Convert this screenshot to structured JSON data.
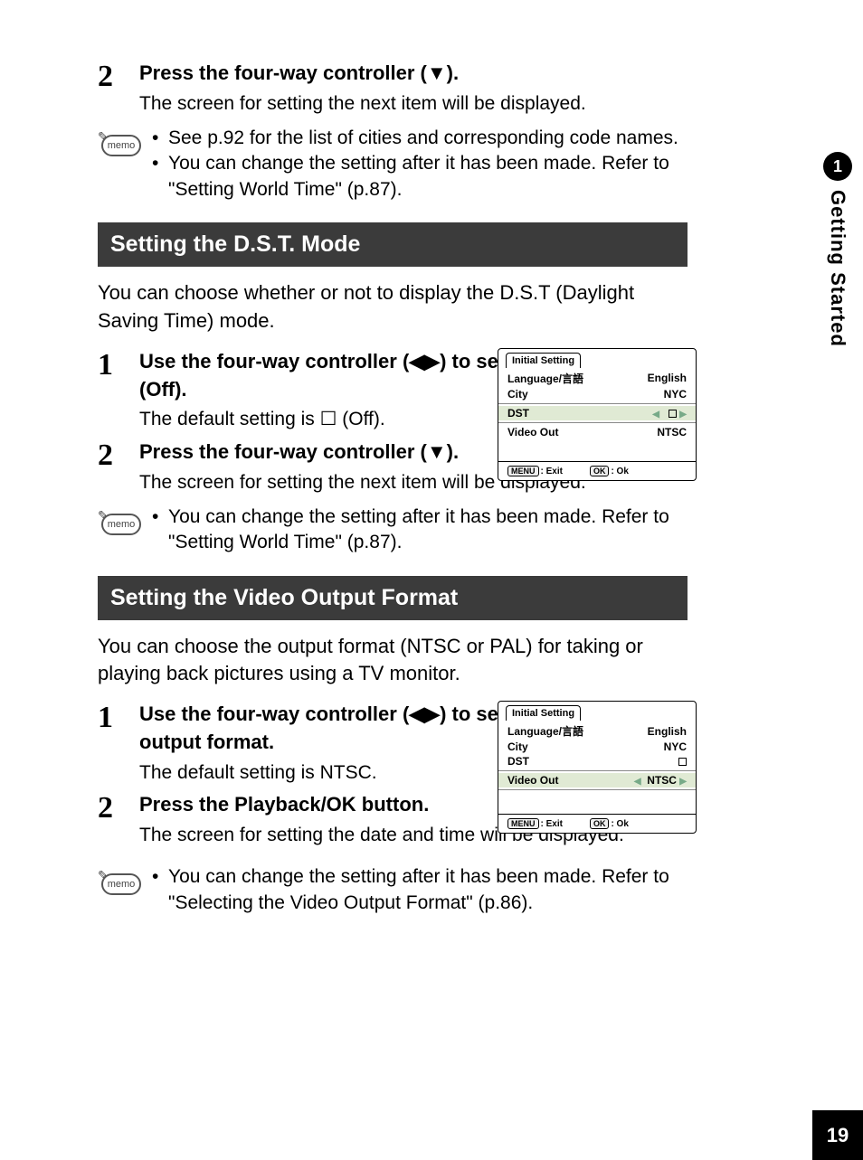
{
  "page_number": "19",
  "side": {
    "chapter_num": "1",
    "chapter_title": "Getting Started"
  },
  "intro_step": {
    "num": "2",
    "head_prefix": "Press the four-way controller (",
    "head_suffix": ").",
    "arrow": "▼",
    "desc": "The screen for setting the next item will be displayed."
  },
  "memo1": {
    "label": "memo",
    "b1": "See p.92 for the list of cities and corresponding code names.",
    "b2": "You can change the setting after it has been made. Refer to \"Setting World Time\" (p.87)."
  },
  "sectionA": {
    "title": "Setting the D.S.T. Mode",
    "intro": "You can choose whether or not to display the D.S.T (Daylight Saving Time) mode.",
    "step1": {
      "num": "1",
      "head": "Use the four-way controller (◀▶) to select ☑ (On) or ☐ (Off).",
      "desc": "The default setting is ☐ (Off)."
    },
    "step2": {
      "num": "2",
      "head_prefix": "Press the four-way controller (",
      "head_suffix": ").",
      "arrow": "▼",
      "desc": "The screen for setting the next item will be displayed."
    }
  },
  "memo2": {
    "label": "memo",
    "text": "You can change the setting after it has been made. Refer to \"Setting World Time\" (p.87)."
  },
  "sectionB": {
    "title": "Setting the Video Output Format",
    "intro": "You can choose the output format (NTSC or PAL) for taking or playing back pictures using a TV monitor.",
    "step1": {
      "num": "1",
      "head": "Use the four-way controller (◀▶) to select the video output format.",
      "desc": "The default setting is NTSC."
    },
    "step2": {
      "num": "2",
      "head": "Press the Playback/OK button.",
      "desc": "The screen for setting the date and time will be displayed."
    }
  },
  "memo3": {
    "label": "memo",
    "text": "You can change the setting after it has been made. Refer to \"Selecting the Video Output Format\" (p.86)."
  },
  "lcd1": {
    "tab": "Initial Setting",
    "r1l": "Language/言語",
    "r1r": "English",
    "r2l": "City",
    "r2r": "NYC",
    "r3l": "DST",
    "r4l": "Video Out",
    "r4r": "NTSC",
    "fl_a": "MENU",
    "fl_b": ": Exit",
    "fr_a": "OK",
    "fr_b": ": Ok"
  },
  "lcd2": {
    "tab": "Initial Setting",
    "r1l": "Language/言語",
    "r1r": "English",
    "r2l": "City",
    "r2r": "NYC",
    "r3l": "DST",
    "r4l": "Video Out",
    "r4r": "NTSC",
    "fl_a": "MENU",
    "fl_b": ": Exit",
    "fr_a": "OK",
    "fr_b": ": Ok"
  }
}
